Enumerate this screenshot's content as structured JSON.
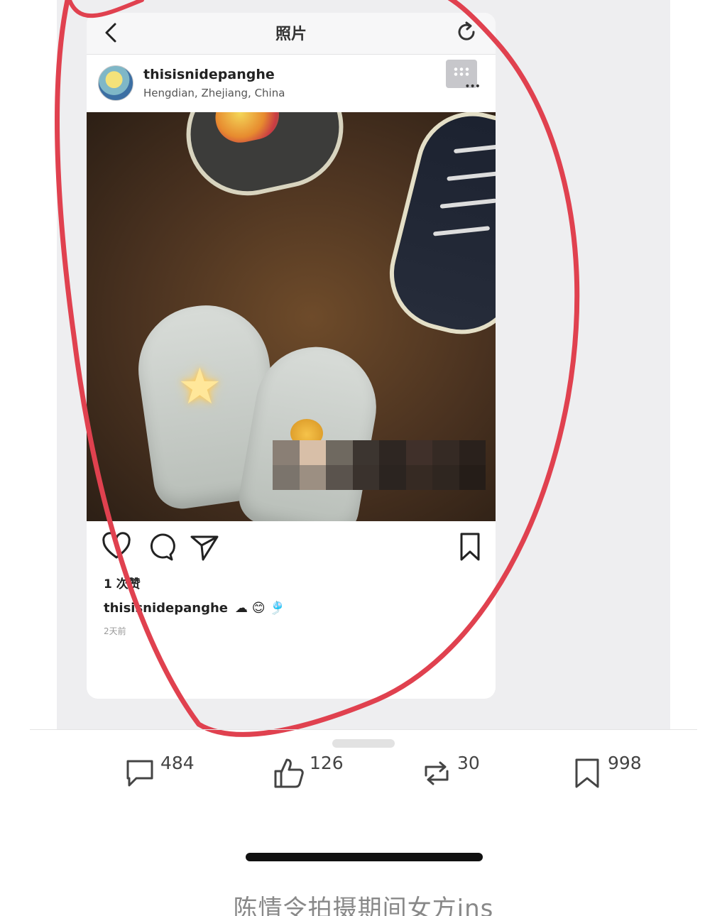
{
  "navbar": {
    "title": "照片",
    "back_icon": "chevron-left-icon",
    "refresh_icon": "refresh-icon"
  },
  "post": {
    "username": "thisisnidepanghe",
    "location": "Hengdian, Zhejiang, China",
    "more_icon": "more-options-icon",
    "likes_text": "1 次赞",
    "caption_user": "thisisnidepanghe",
    "caption_emoji": "☁ 😊 🎐",
    "time_text": "2天前"
  },
  "stats": {
    "comments": "484",
    "likes": "126",
    "reposts": "30",
    "favorites": "998"
  },
  "footer": {
    "caption": "陈情令拍摄期间女方ins"
  },
  "colors": {
    "annotation_red": "#e0414f",
    "backdrop": "#eeeef0"
  }
}
